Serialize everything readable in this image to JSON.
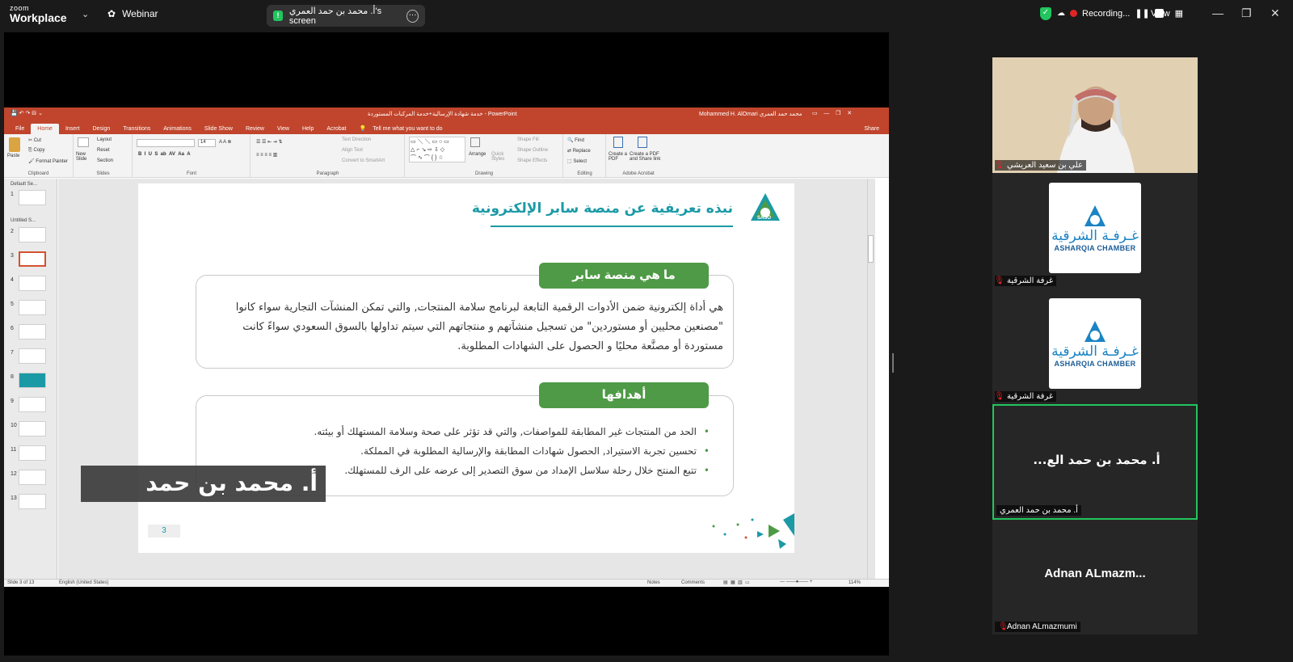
{
  "topbar": {
    "logo_small": "zoom",
    "logo_large": "Workplace",
    "webinar_label": "Webinar",
    "share_indicator": "أ. محمد بن حمد العمري's screen",
    "recording_label": "Recording...",
    "view_label": "View"
  },
  "ppt": {
    "title": "خدمة شهادة الإرسالية+خدمة المركبات المستوردة  -  PowerPoint",
    "account": "Mohammed H. AlOmari محمد حمد العمري",
    "share_label": "Share",
    "tabs": [
      "File",
      "Home",
      "Insert",
      "Design",
      "Transitions",
      "Animations",
      "Slide Show",
      "Review",
      "View",
      "Help",
      "Acrobat"
    ],
    "tell_me": "Tell me what you want to do",
    "ribbon": {
      "clipboard": {
        "label": "Clipboard",
        "paste": "Paste",
        "cut": "Cut",
        "copy": "Copy",
        "format_painter": "Format Painter"
      },
      "slides": {
        "label": "Slides",
        "new_slide": "New Slide",
        "layout": "Layout",
        "reset": "Reset",
        "section": "Section"
      },
      "font": {
        "label": "Font",
        "size": "14"
      },
      "paragraph": {
        "label": "Paragraph",
        "text_direction": "Text Direction",
        "align_text": "Align Text",
        "smartart": "Convert to SmartArt"
      },
      "drawing": {
        "label": "Drawing",
        "arrange": "Arrange",
        "quick_styles": "Quick Styles",
        "shape_fill": "Shape Fill",
        "shape_outline": "Shape Outline",
        "shape_effects": "Shape Effects"
      },
      "editing": {
        "label": "Editing",
        "find": "Find",
        "replace": "Replace",
        "select": "Select"
      },
      "acrobat": {
        "label": "Adobe Acrobat",
        "create_pdf": "Create a PDF",
        "create_share": "Create a PDF and Share link"
      }
    },
    "sections": [
      "Default Se...",
      "Untitled S..."
    ],
    "slide_numbers": [
      "1",
      "2",
      "3",
      "4",
      "5",
      "6",
      "7",
      "8",
      "9",
      "10",
      "11",
      "12",
      "13"
    ],
    "status": {
      "slide": "Slide 3 of 13",
      "language": "English (United States)",
      "notes": "Notes",
      "comments": "Comments",
      "zoom": "114%"
    }
  },
  "slide": {
    "title": "نبذه تعريفية عن  منصة سابر  الإلكترونية",
    "logo_text": "SASO",
    "section1_heading": "ما هي منصة سابر",
    "section1_lines": [
      "هي أداة إلكترونية ضمن الأدوات الرقمية التابعة لبرنامج سلامة المنتجات, والتي تمكن المنشآت التجارية سواء كانوا",
      "\"مصنعين محليين أو مستوردين\" من تسجيل منشآتهم و منتجاتهم التي سيتم تداولها بالسوق السعودي سواءً كانت",
      "مستوردة أو مصنَّعة محليًا و الحصول على الشهادات المطلوبة."
    ],
    "section2_heading": "أهدافها",
    "goals": [
      "الحد من المنتجات غير المطابقة للمواصفات, والتي قد تؤثر على صحة وسلامة المستهلك أو بيئته.",
      "تحسين تجربة الاستيراد, الحصول شهادات المطابقة والإرسالية المطلوبة في المملكة.",
      "تتبع المنتج خلال رحلة سلاسل الإمداد من سوق التصدير إلى عرضه على الرف للمستهلك."
    ],
    "page_number": "3"
  },
  "caption": "أ. محمد بن حمد الع...",
  "participants": [
    {
      "name": "علي بن سعيد العريشي",
      "type": "video"
    },
    {
      "name": "غرفة الشرقية",
      "type": "logo",
      "logo_ar": "غـرفـة الشرقية",
      "logo_en": "ASHARQIA CHAMBER"
    },
    {
      "name": "غرفة الشرقية",
      "type": "logo",
      "logo_ar": "غـرفـة الشرقية",
      "logo_en": "ASHARQIA CHAMBER"
    },
    {
      "name": "أ. محمد بن حمد العمري",
      "type": "name",
      "display": "أ. محمد بن حمد الع..."
    },
    {
      "name": "Adnan ALmazmumi",
      "type": "name",
      "display": "Adnan  ALmazm..."
    }
  ]
}
